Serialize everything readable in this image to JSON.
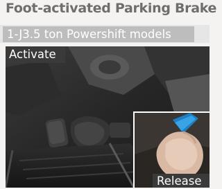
{
  "header": {
    "title": "Foot-activated Parking Brake",
    "subtitle": "1-J3.5 ton Powershift models"
  },
  "photo": {
    "activate_label": "Activate",
    "release_label": "Release"
  }
}
